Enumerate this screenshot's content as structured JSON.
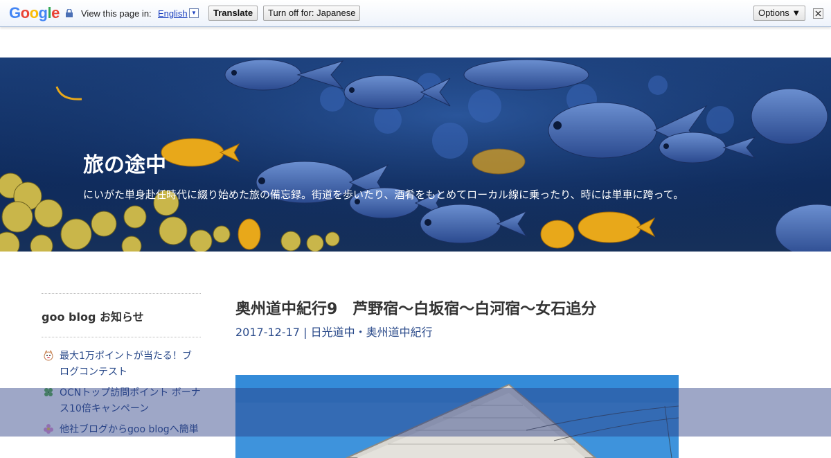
{
  "translate_bar": {
    "logo": "Google",
    "view_label": "View this page in:",
    "language": "English",
    "dropdown_glyph": "▼",
    "translate_button": "Translate",
    "turn_off_button": "Turn off for: Japanese",
    "options_button": "Options ▼",
    "close_glyph": "✕"
  },
  "header": {
    "title": "旅の途中",
    "description": "にいがた単身赴任時代に綴り始めた旅の備忘録。街道を歩いたり、酒肴をもとめてローカル線に乗ったり、時には単車に跨って。"
  },
  "sidebar": {
    "heading": "goo blog お知らせ",
    "items": [
      {
        "label": "最大1万ポイントが当たる！ブログコンテスト",
        "icon": "goo-mascot-icon"
      },
      {
        "label": "OCNトップ訪問ポイント ボーナス10倍キャンペーン",
        "icon": "clover-icon"
      },
      {
        "label": "他社ブログからgoo blogへ簡単",
        "icon": "flower-icon"
      }
    ]
  },
  "post": {
    "title": "奥州道中紀行9　芦野宿～白坂宿～白河宿～女石追分",
    "date": "2017-12-17",
    "separator": "|",
    "category": "日光道中・奥州道中紀行"
  },
  "colors": {
    "link": "#2a4a8a",
    "text": "#333333",
    "banner_deep": "#0f2b5c"
  }
}
